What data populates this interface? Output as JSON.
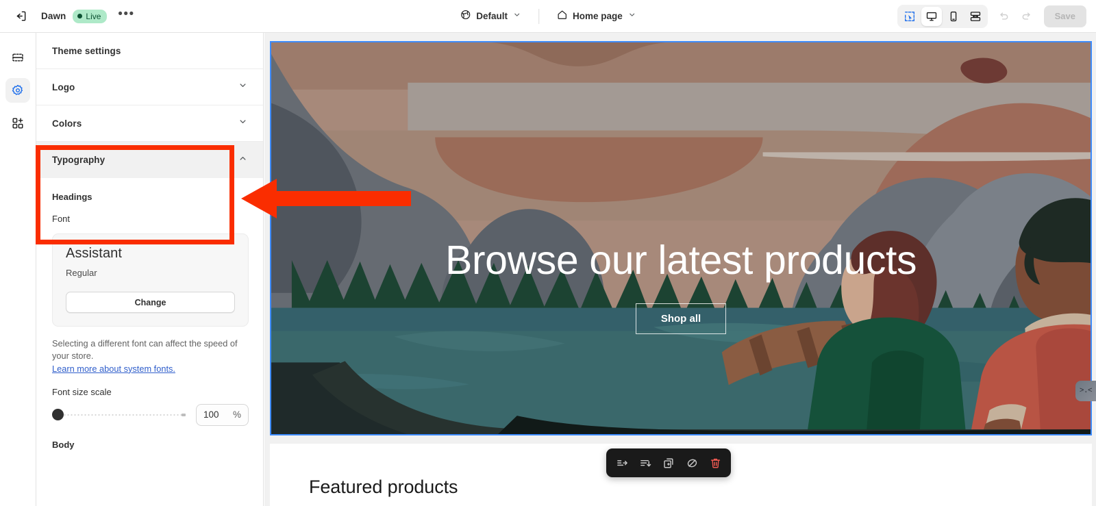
{
  "topbar": {
    "exit_icon": "exit-door-icon",
    "theme_name": "Dawn",
    "live_label": "Live",
    "more_label": "•••",
    "globe_icon": "globe-icon",
    "locale": "Default",
    "home_icon": "home-icon",
    "page": "Home page",
    "view_modes": [
      {
        "name": "inspector",
        "icon": "cursor-select-icon",
        "selected": false
      },
      {
        "name": "desktop",
        "icon": "desktop-icon",
        "selected": true
      },
      {
        "name": "mobile",
        "icon": "mobile-icon",
        "selected": false
      },
      {
        "name": "fullscreen",
        "icon": "fullwidth-icon",
        "selected": false
      }
    ],
    "undo_icon": "undo-icon",
    "redo_icon": "redo-icon",
    "save_label": "Save",
    "save_disabled": true
  },
  "rail": {
    "items": [
      {
        "name": "sections",
        "icon": "sections-icon",
        "active": false
      },
      {
        "name": "theme-settings",
        "icon": "gear-icon",
        "active": true
      },
      {
        "name": "app-embeds",
        "icon": "apps-grid-plus-icon",
        "active": false
      }
    ],
    "active_color": "#1f6feb"
  },
  "panel": {
    "header": "Theme settings",
    "sections": [
      {
        "title": "Logo",
        "expanded": false,
        "chevron": "chevron-down-icon"
      },
      {
        "title": "Colors",
        "expanded": false,
        "chevron": "chevron-down-icon"
      },
      {
        "title": "Typography",
        "expanded": true,
        "chevron": "chevron-up-icon"
      }
    ],
    "typography": {
      "headings_label": "Headings",
      "font_label": "Font",
      "font_name": "Assistant",
      "font_weight": "Regular",
      "change_button": "Change",
      "help_text": "Selecting a different font can affect the speed of your store.",
      "help_link": "Learn more about system fonts.",
      "link_color": "#2f5ecb",
      "font_size_scale_label": "Font size scale",
      "font_size_scale_value": "100",
      "font_size_scale_unit": "%",
      "slider_position_pct": 0,
      "body_label": "Body"
    }
  },
  "preview": {
    "selection_color": "#3d8bfd",
    "hero": {
      "title": "Browse our latest products",
      "button_label": "Shop all",
      "illustration": "lake-canoe-couple-mountains-illustration",
      "palette": {
        "sky_tan": "#a7897a",
        "sky_brown": "#9a7360",
        "sky_grey": "#a09a96",
        "mountain_grey": "#666b72",
        "mountain_dark": "#4d535b",
        "rock_rust": "#9d6a59",
        "tree_green": "#1c4332",
        "water_teal": "#3a686b",
        "water_teal_dark": "#325a60",
        "canoe_dark": "#1f2a2a",
        "shirt_green": "#15513a",
        "shirt_red": "#b85444",
        "hair_brown": "#5d2f2a",
        "hair_black": "#1e2a24",
        "skin_light": "#c9a48c",
        "skin_dark": "#7b4b36",
        "oar_brown": "#8a5c42"
      }
    },
    "section_toolbar": {
      "buttons": [
        {
          "name": "move-up",
          "icon": "move-up-icon"
        },
        {
          "name": "move-down",
          "icon": "move-down-icon"
        },
        {
          "name": "duplicate",
          "icon": "duplicate-icon"
        },
        {
          "name": "hide",
          "icon": "hide-eye-icon"
        },
        {
          "name": "delete",
          "icon": "trash-icon",
          "color": "#f05a52"
        }
      ]
    },
    "featured_title": "Featured products",
    "chat_widget": {
      "icon": "chat-face-icon",
      "face": ">.<"
    }
  },
  "annotation": {
    "color": "#fa2d00",
    "box_target": "typography-section",
    "arrow": "left-pointing-arrow"
  }
}
